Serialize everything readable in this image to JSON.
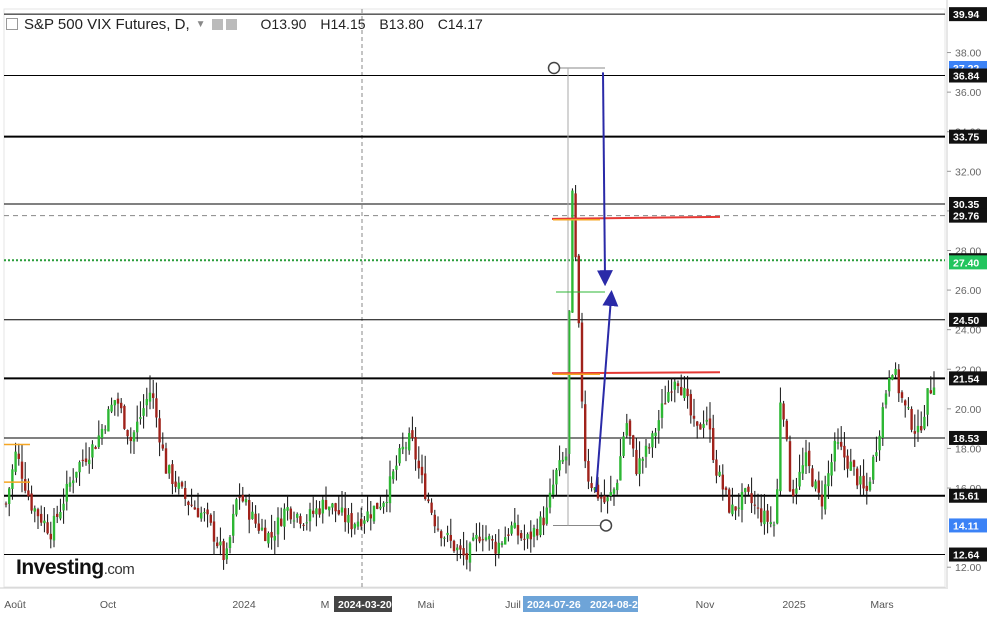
{
  "header": {
    "symbol": "S&P 500 VIX Futures, D,",
    "open": "O13.90",
    "high": "H14.15",
    "low": "B13.80",
    "close": "C14.17"
  },
  "logo": {
    "brand": "Investing",
    "suffix": ".com"
  },
  "chart_data": {
    "type": "candlestick",
    "title": "S&P 500 VIX Futures, D",
    "ylim": [
      11.0,
      40.2
    ],
    "y_ticks": [
      "12.00",
      "16.00",
      "18.00",
      "20.00",
      "22.00",
      "24.00",
      "26.00",
      "28.00",
      "30.00",
      "32.00",
      "34.00",
      "36.00",
      "38.00"
    ],
    "x_labels": [
      "Août",
      "Oct",
      "2024",
      "M",
      "Mai",
      "Juil",
      "Nov",
      "2025",
      "Mars"
    ],
    "highlighted_dates": [
      "2024-03-20",
      "2024-07-26",
      "2024-08-29"
    ],
    "horizontal_levels": [
      {
        "value": 39.94,
        "label": "39.94",
        "color": "#000000"
      },
      {
        "value": 37.22,
        "label": "37.22",
        "color": "#2962ff"
      },
      {
        "value": 36.84,
        "label": "36.84",
        "color": "#000000"
      },
      {
        "value": 33.75,
        "label": "33.75",
        "color": "#000000"
      },
      {
        "value": 30.35,
        "label": "30.35",
        "color": "#000000"
      },
      {
        "value": 29.76,
        "label": "29.76",
        "color": "#000000"
      },
      {
        "value": 27.51,
        "label": "27.51",
        "color": "#000000"
      },
      {
        "value": 27.4,
        "label": "27.40",
        "color": "#22bb22"
      },
      {
        "value": 24.5,
        "label": "24.50",
        "color": "#000000"
      },
      {
        "value": 21.54,
        "label": "21.54",
        "color": "#000000"
      },
      {
        "value": 18.53,
        "label": "18.53",
        "color": "#000000"
      },
      {
        "value": 15.61,
        "label": "15.61",
        "color": "#000000"
      },
      {
        "value": 14.11,
        "label": "14.11",
        "color": "#2962ff"
      },
      {
        "value": 12.64,
        "label": "12.64",
        "color": "#000000"
      }
    ],
    "close_anchors": [
      [
        0,
        15.2
      ],
      [
        10,
        17.8
      ],
      [
        25,
        15.2
      ],
      [
        45,
        13.8
      ],
      [
        70,
        17.0
      ],
      [
        90,
        18.3
      ],
      [
        110,
        20.6
      ],
      [
        125,
        18.4
      ],
      [
        145,
        21.0
      ],
      [
        160,
        17.0
      ],
      [
        180,
        15.4
      ],
      [
        200,
        14.5
      ],
      [
        220,
        12.3
      ],
      [
        232,
        15.8
      ],
      [
        250,
        14.2
      ],
      [
        265,
        13.5
      ],
      [
        280,
        15.0
      ],
      [
        300,
        14.4
      ],
      [
        320,
        15.3
      ],
      [
        345,
        14.2
      ],
      [
        365,
        14.8
      ],
      [
        380,
        15.6
      ],
      [
        395,
        17.8
      ],
      [
        405,
        18.5
      ],
      [
        415,
        16.5
      ],
      [
        430,
        14.2
      ],
      [
        445,
        13.2
      ],
      [
        460,
        12.4
      ],
      [
        475,
        13.8
      ],
      [
        490,
        13.0
      ],
      [
        505,
        14.0
      ],
      [
        520,
        13.3
      ],
      [
        540,
        14.6
      ],
      [
        550,
        16.7
      ],
      [
        560,
        17.6
      ],
      [
        566,
        31.0
      ],
      [
        570,
        27.0
      ],
      [
        575,
        21.5
      ],
      [
        580,
        16.8
      ],
      [
        590,
        15.8
      ],
      [
        600,
        15.2
      ],
      [
        610,
        16.1
      ],
      [
        620,
        19.5
      ],
      [
        630,
        17.0
      ],
      [
        645,
        18.2
      ],
      [
        660,
        20.6
      ],
      [
        670,
        21.8
      ],
      [
        680,
        20.5
      ],
      [
        690,
        18.7
      ],
      [
        700,
        19.8
      ],
      [
        710,
        17.0
      ],
      [
        725,
        14.8
      ],
      [
        740,
        15.6
      ],
      [
        755,
        14.6
      ],
      [
        770,
        14.1
      ],
      [
        775,
        21.4
      ],
      [
        785,
        15.6
      ],
      [
        800,
        17.4
      ],
      [
        815,
        15.2
      ],
      [
        830,
        18.2
      ],
      [
        845,
        17.1
      ],
      [
        860,
        15.6
      ],
      [
        872,
        18.6
      ],
      [
        885,
        22.4
      ],
      [
        898,
        20.1
      ],
      [
        912,
        18.7
      ],
      [
        922,
        20.7
      ],
      [
        928,
        21.5
      ],
      [
        932,
        27.4
      ]
    ]
  }
}
